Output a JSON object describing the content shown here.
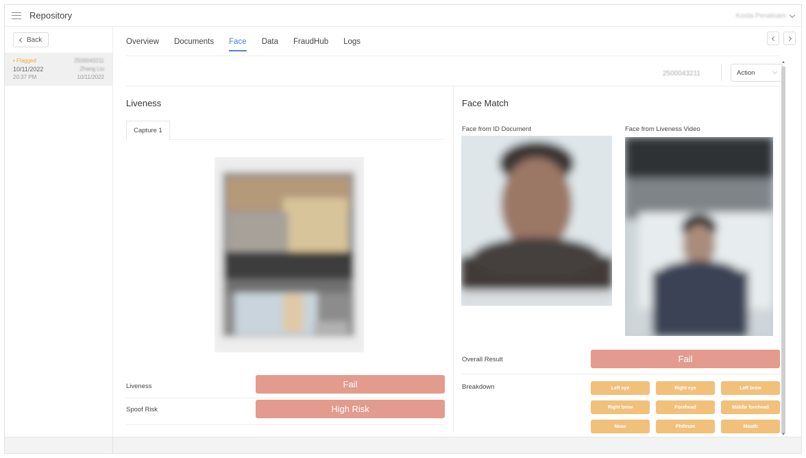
{
  "app": {
    "title": "Repository",
    "user_name": "Kosta Penaloam"
  },
  "sidebar": {
    "back_label": "Back",
    "record": {
      "status": "• Flagged",
      "id": "2500043211",
      "date": "10/11/2022",
      "name": "Zhang Liu",
      "time": "20:37 PM",
      "date2": "10/11/2022"
    }
  },
  "tabs": [
    {
      "label": "Overview",
      "active": false
    },
    {
      "label": "Documents",
      "active": false
    },
    {
      "label": "Face",
      "active": true
    },
    {
      "label": "Data",
      "active": false
    },
    {
      "label": "FraudHub",
      "active": false
    },
    {
      "label": "Logs",
      "active": false
    }
  ],
  "action_row": {
    "record_id": "2500043211",
    "action_label": "Action"
  },
  "liveness": {
    "title": "Liveness",
    "capture_tab": "Capture 1",
    "rows": [
      {
        "label": "Liveness",
        "value": "Fail"
      },
      {
        "label": "Spoof Risk",
        "value": "High Risk"
      }
    ]
  },
  "face_match": {
    "title": "Face Match",
    "id_doc_label": "Face from ID Document",
    "video_label": "Face from Liveness Video",
    "overall_label": "Overall Result",
    "overall_value": "Fail",
    "breakdown_label": "Breakdown",
    "breakdown": [
      "Left eye",
      "Right eye",
      "Left brow",
      "Right brow",
      "Forehead",
      "Middle forehead",
      "Nose",
      "Philtrum",
      "Mouth"
    ]
  },
  "colors": {
    "accent": "#4a82d8",
    "fail": "#e29b8d",
    "chip": "#f1c07a",
    "flag": "#f0a844"
  }
}
